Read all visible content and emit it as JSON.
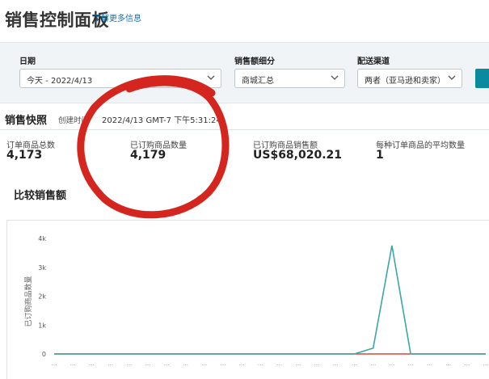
{
  "header": {
    "title": "销售控制面板",
    "learn_more": "了解更多信息"
  },
  "filters": {
    "date": {
      "label": "日期",
      "value": "今天 - 2022/4/13"
    },
    "sales_breakdown": {
      "label": "销售额细分",
      "value": "商城汇总"
    },
    "fulfillment_channel": {
      "label": "配送渠道",
      "value": "两者（亚马逊和卖家）"
    }
  },
  "snapshot": {
    "title": "销售快照",
    "created_label": "创建时间",
    "created_time": "2022/4/13 GMT-7 下午5:31:24",
    "metrics": [
      {
        "label": "订单商品总数",
        "value": "4,173"
      },
      {
        "label": "已订购商品数量",
        "value": "4,179"
      },
      {
        "label": "已订购商品销售额",
        "value": "US$68,020.21"
      },
      {
        "label": "每种订单商品的平均数量",
        "value": "1"
      }
    ]
  },
  "compare": {
    "title": "比较销售额"
  },
  "colors": {
    "accent": "#0a8a9e",
    "series_today": "#3aa6a6",
    "series_compare": "#d9473b",
    "annotation": "#d4251f"
  },
  "chart_data": {
    "type": "line",
    "ylabel": "已订购商品数量",
    "ylim": [
      0,
      4000
    ],
    "yticks": [
      "0",
      "1k",
      "2k",
      "3k",
      "4k"
    ],
    "x": [
      "…",
      "…",
      "…",
      "…",
      "…",
      "…",
      "…",
      "…",
      "…",
      "…",
      "…",
      "…",
      "…",
      "…",
      "…",
      "…",
      "…",
      "…",
      "…",
      "…",
      "…",
      "…",
      "…",
      "…"
    ],
    "series": [
      {
        "values": [
          0,
          0,
          0,
          0,
          0,
          0,
          0,
          0,
          0,
          0,
          0,
          0,
          0,
          0,
          0,
          0,
          0,
          200,
          3750,
          0,
          0,
          0,
          0,
          0
        ]
      },
      {
        "values": [
          0,
          0,
          0,
          0,
          0,
          0,
          0,
          0,
          0,
          0,
          0,
          0,
          0,
          0,
          0,
          0,
          0,
          0,
          0,
          0,
          0,
          0,
          0,
          0
        ]
      }
    ]
  }
}
